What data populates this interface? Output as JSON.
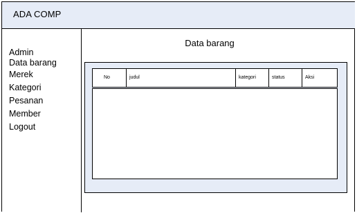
{
  "header": {
    "app_title": "ADA COMP"
  },
  "sidebar": {
    "items": [
      {
        "label": "Admin"
      },
      {
        "label": "Data barang"
      },
      {
        "label": "Merek"
      },
      {
        "label": "Kategori"
      },
      {
        "label": "Pesanan"
      },
      {
        "label": "Member"
      },
      {
        "label": "Logout"
      }
    ]
  },
  "main": {
    "page_title": "Data barang",
    "table": {
      "columns": [
        "No",
        "judul",
        "kategori",
        "status",
        "Aksi"
      ],
      "rows": []
    }
  },
  "colors": {
    "header_background": "#e6ecf7",
    "panel_background": "#e6ecf7",
    "border": "#000000"
  }
}
